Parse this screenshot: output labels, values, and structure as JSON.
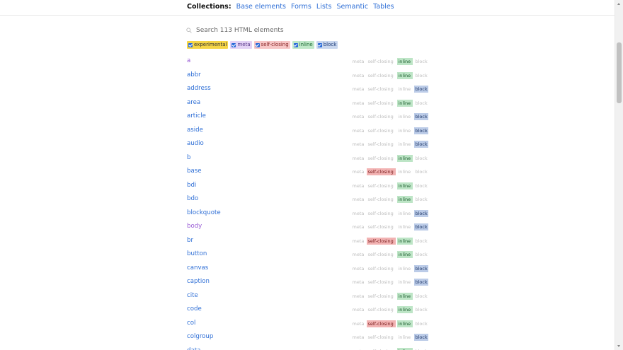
{
  "collections": {
    "label": "Collections:",
    "links": [
      "Base elements",
      "Forms",
      "Lists",
      "Semantic",
      "Tables"
    ]
  },
  "search": {
    "placeholder": "Search 113 HTML elements",
    "value": ""
  },
  "filters": [
    {
      "label": "experimental",
      "checked": true
    },
    {
      "label": "meta",
      "checked": true
    },
    {
      "label": "self-closing",
      "checked": true
    },
    {
      "label": "inline",
      "checked": true
    },
    {
      "label": "block",
      "checked": true
    }
  ],
  "tag_labels": {
    "meta": "meta",
    "self": "self-closing",
    "inline": "inline",
    "block": "block"
  },
  "elements": [
    {
      "name": "a",
      "visited": true,
      "meta": false,
      "self": false,
      "inline": true,
      "block": false
    },
    {
      "name": "abbr",
      "visited": false,
      "meta": false,
      "self": false,
      "inline": true,
      "block": false
    },
    {
      "name": "address",
      "visited": false,
      "meta": false,
      "self": false,
      "inline": false,
      "block": true
    },
    {
      "name": "area",
      "visited": false,
      "meta": false,
      "self": false,
      "inline": true,
      "block": false
    },
    {
      "name": "article",
      "visited": false,
      "meta": false,
      "self": false,
      "inline": false,
      "block": true
    },
    {
      "name": "aside",
      "visited": false,
      "meta": false,
      "self": false,
      "inline": false,
      "block": true
    },
    {
      "name": "audio",
      "visited": false,
      "meta": false,
      "self": false,
      "inline": false,
      "block": true
    },
    {
      "name": "b",
      "visited": false,
      "meta": false,
      "self": false,
      "inline": true,
      "block": false
    },
    {
      "name": "base",
      "visited": false,
      "meta": false,
      "self": true,
      "inline": false,
      "block": false
    },
    {
      "name": "bdi",
      "visited": false,
      "meta": false,
      "self": false,
      "inline": true,
      "block": false
    },
    {
      "name": "bdo",
      "visited": false,
      "meta": false,
      "self": false,
      "inline": true,
      "block": false
    },
    {
      "name": "blockquote",
      "visited": false,
      "meta": false,
      "self": false,
      "inline": false,
      "block": true
    },
    {
      "name": "body",
      "visited": true,
      "meta": false,
      "self": false,
      "inline": false,
      "block": true
    },
    {
      "name": "br",
      "visited": false,
      "meta": false,
      "self": true,
      "inline": true,
      "block": false
    },
    {
      "name": "button",
      "visited": false,
      "meta": false,
      "self": false,
      "inline": true,
      "block": false
    },
    {
      "name": "canvas",
      "visited": false,
      "meta": false,
      "self": false,
      "inline": false,
      "block": true
    },
    {
      "name": "caption",
      "visited": false,
      "meta": false,
      "self": false,
      "inline": false,
      "block": true
    },
    {
      "name": "cite",
      "visited": false,
      "meta": false,
      "self": false,
      "inline": true,
      "block": false
    },
    {
      "name": "code",
      "visited": false,
      "meta": false,
      "self": false,
      "inline": true,
      "block": false
    },
    {
      "name": "col",
      "visited": false,
      "meta": false,
      "self": true,
      "inline": true,
      "block": false
    },
    {
      "name": "colgroup",
      "visited": false,
      "meta": false,
      "self": false,
      "inline": false,
      "block": true
    },
    {
      "name": "data",
      "visited": false,
      "meta": false,
      "self": false,
      "inline": true,
      "block": false
    }
  ],
  "colors": {
    "link": "#2f6fd6",
    "visited": "#9b5fd6",
    "inline_on": "#bde5c6",
    "block_on": "#bccce8",
    "self_on": "#f2b3b3",
    "experimental": "#f5d547",
    "checkbox": "#2b6cd9"
  }
}
